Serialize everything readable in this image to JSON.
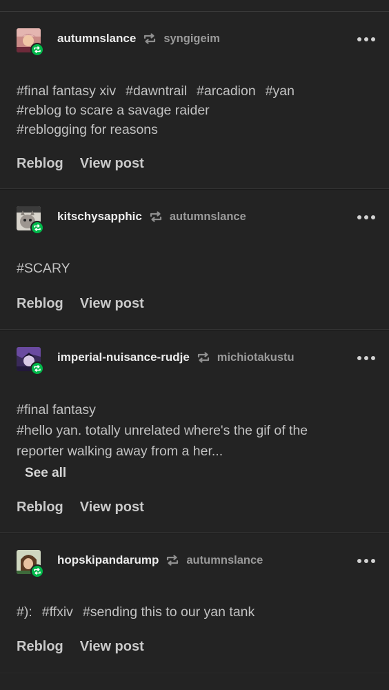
{
  "colors": {
    "background": "#232323",
    "badge": "#00b84a",
    "text_primary": "#ececec",
    "text_secondary": "#9a9a9a"
  },
  "notes": [
    {
      "username": "autumnslance",
      "source": "syngigeim",
      "avatar_icon": "avatar-autumnslance",
      "tag_lines": [
        [
          "#final fantasy xiv",
          "#dawntrail",
          "#arcadion",
          "#yan"
        ],
        [
          "#reblog to scare a savage raider"
        ],
        [
          "#reblogging for reasons"
        ]
      ],
      "actions": {
        "reblog": "Reblog",
        "view": "View post"
      }
    },
    {
      "username": "kitschysapphic",
      "source": "autumnslance",
      "avatar_icon": "avatar-kitschysapphic",
      "tag_lines": [
        [
          "#SCARY"
        ]
      ],
      "actions": {
        "reblog": "Reblog",
        "view": "View post"
      }
    },
    {
      "username": "imperial-nuisance-rudje",
      "source": "michiotakustu",
      "avatar_icon": "avatar-imperial-nuisance-rudje",
      "tag_lines": [
        [
          "#final fantasy"
        ],
        [
          "#hello yan. totally unrelated where's the gif of the"
        ],
        [
          "reporter walking away from a her..."
        ]
      ],
      "see_all": "See all",
      "actions": {
        "reblog": "Reblog",
        "view": "View post"
      }
    },
    {
      "username": "hopskipandarump",
      "source": "autumnslance",
      "avatar_icon": "avatar-hopskipandarump",
      "tag_lines": [
        [
          "#):",
          "#ffxiv",
          "#sending this to our yan tank"
        ]
      ],
      "actions": {
        "reblog": "Reblog",
        "view": "View post"
      }
    }
  ]
}
